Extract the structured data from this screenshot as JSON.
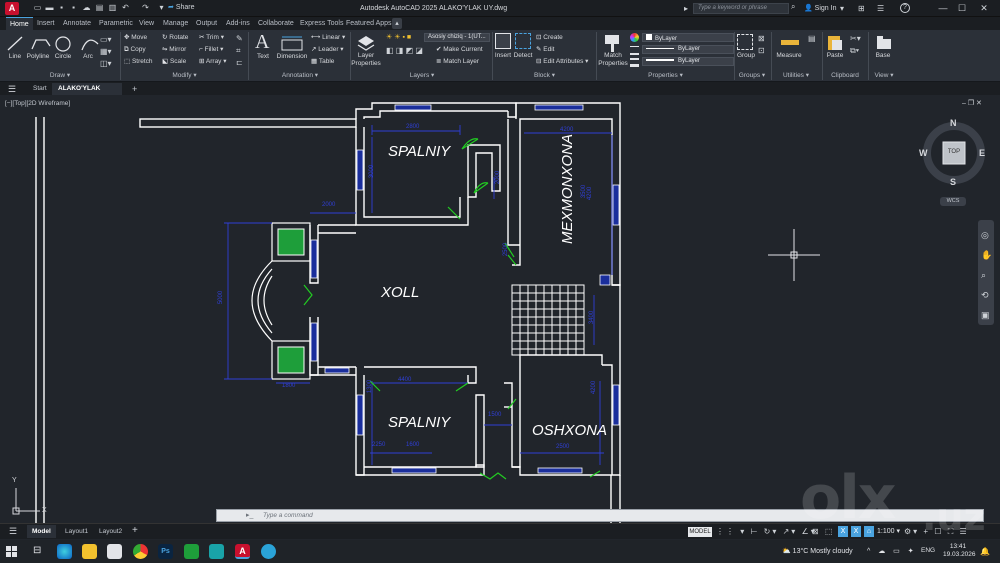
{
  "app": {
    "logo_letter": "A",
    "window_title": "Autodesk AutoCAD 2025   ALAKO'YLAK UY.dwg",
    "share_label": "Share",
    "search_placeholder": "Type a keyword or phrase",
    "sign_in": "Sign In",
    "help_icon": "?"
  },
  "ribbon_tabs": [
    "Home",
    "Insert",
    "Annotate",
    "Parametric",
    "View",
    "Manage",
    "Output",
    "Add-ins",
    "Collaborate",
    "Express Tools",
    "Featured Apps"
  ],
  "ribbon": {
    "draw": {
      "title": "Draw ▾",
      "line": "Line",
      "polyline": "Polyline",
      "circle": "Circle",
      "arc": "Arc"
    },
    "modify": {
      "title": "Modify ▾",
      "move": "Move",
      "rotate": "Rotate",
      "trim": "Trim ▾",
      "copy": "Copy",
      "mirror": "Mirror",
      "fillet": "Fillet ▾",
      "stretch": "Stretch",
      "scale": "Scale",
      "array": "Array ▾"
    },
    "annotation": {
      "title": "Annotation ▾",
      "text": "Text",
      "dimension": "Dimension",
      "linear": "Linear ▾",
      "leader": "Leader ▾",
      "table": "Table"
    },
    "layers": {
      "title": "Layers ▾",
      "layer_properties": "Layer Properties",
      "layer_dropdown": "Asosiy chiziq - 1(UT...",
      "make_current": "Make Current",
      "match_layer": "Match Layer"
    },
    "block": {
      "title": "Block ▾",
      "insert": "Insert",
      "detect": "Detect",
      "create": "Create",
      "edit": "Edit",
      "edit_attributes": "Edit Attributes ▾"
    },
    "properties": {
      "title": "Properties ▾",
      "match_properties": "Match Properties",
      "color": "ByLayer",
      "linetype": "ByLayer",
      "lineweight": "ByLayer"
    },
    "groups": {
      "title": "Groups ▾",
      "group": "Group"
    },
    "utilities": {
      "title": "Utilities ▾",
      "measure": "Measure"
    },
    "clipboard": {
      "title": "Clipboard",
      "paste": "Paste"
    },
    "view": {
      "title": "View ▾",
      "base": "Base"
    }
  },
  "file_tabs": {
    "start": "Start",
    "active": "ALAKO'YLAK UY*",
    "new": "+"
  },
  "viewport": {
    "label": "[−][Top][2D Wireframe]",
    "viewcube_top": "TOP",
    "compass": {
      "n": "N",
      "s": "S",
      "e": "E",
      "w": "W"
    },
    "wcs": "WCS",
    "ucs_y": "Y",
    "ucs_x": "X"
  },
  "drawing": {
    "rooms": [
      "SPALNIY",
      "MEXMONXONA",
      "XOLL",
      "SPALNIY",
      "OSHXONA"
    ],
    "dims": [
      "2800",
      "4200",
      "3000",
      "2000",
      "4200",
      "5000",
      "3400",
      "2000",
      "1800",
      "4400",
      "4200",
      "1500",
      "2500",
      "2250",
      "1600",
      "1300",
      "2500",
      "3500"
    ],
    "colors": {
      "wall": "#ffffff",
      "dimension": "#2f3fd6",
      "door": "#22cc22",
      "stair": "#ffffff"
    }
  },
  "command_line": {
    "placeholder": "Type a command"
  },
  "layout_tabs": [
    "Model",
    "Layout1",
    "Layout2"
  ],
  "status": {
    "model": "MODEL",
    "scale": "1:100"
  },
  "taskbar": {
    "weather": "13°C  Mostly cloudy",
    "lang": "ENG",
    "time": "13:41",
    "date": "19.03.2026"
  },
  "watermark": {
    "text": "olx",
    "domain": ".uz"
  }
}
